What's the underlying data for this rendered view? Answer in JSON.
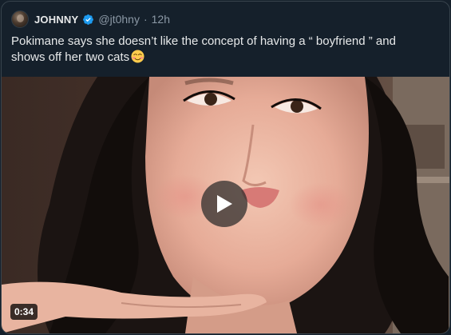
{
  "tweet": {
    "display_name": "JOHNNY",
    "handle": "@jt0hny",
    "separator": "·",
    "time": "12h",
    "text_line1": "Pokimane says she doesn’t like the concept of having a “ boyfriend ” and",
    "text_line2": "shows off her two cats",
    "emoji": "smiling-face-with-blush-emoji",
    "verified_color": "#1d9bf0"
  },
  "media": {
    "type": "video",
    "duration": "0:34",
    "play_icon": "play-icon"
  },
  "colors": {
    "background": "#15202b",
    "text": "#e7e9ea",
    "secondary_text": "#8b98a5",
    "border": "#38444d"
  }
}
